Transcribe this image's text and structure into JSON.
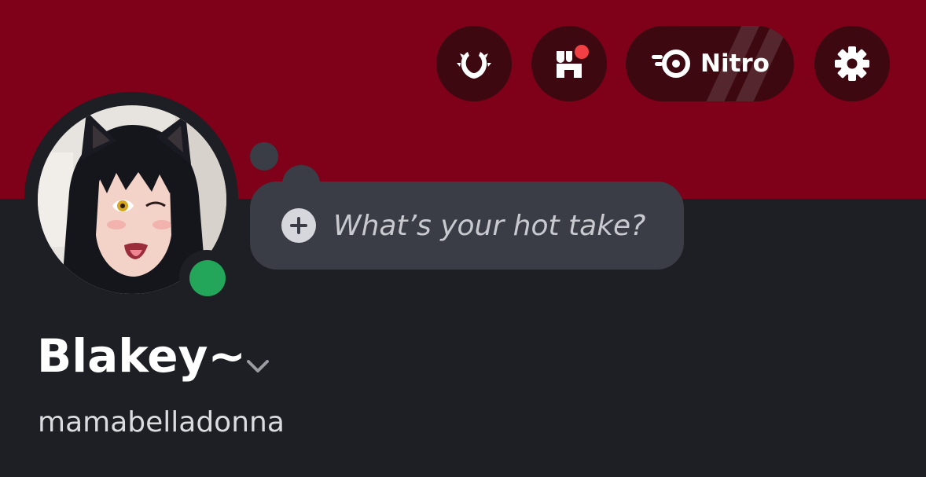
{
  "header": {
    "banner_color": "#7e0019",
    "buttons": [
      {
        "icon": "laurel-wreath-icon"
      },
      {
        "icon": "shop-icon",
        "has_notification": true
      },
      {
        "icon": "nitro-icon",
        "label": "Nitro"
      },
      {
        "icon": "gear-icon"
      }
    ]
  },
  "avatar": {
    "status": "online",
    "status_color": "#23a55a"
  },
  "status_prompt": {
    "icon": "plus-circle-icon",
    "placeholder": "What’s your hot take?"
  },
  "profile": {
    "display_name": "Blakey~",
    "username": "mamabelladonna"
  }
}
